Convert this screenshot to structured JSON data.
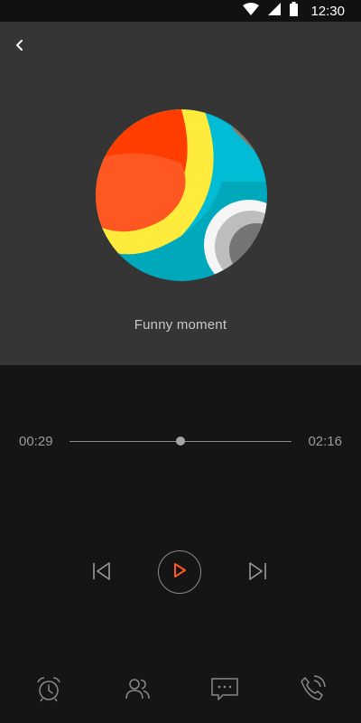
{
  "status_bar": {
    "time": "12:30",
    "icons": [
      "wifi-icon",
      "signal-icon",
      "battery-icon"
    ]
  },
  "header": {
    "back_icon": "chevron-left-icon"
  },
  "track": {
    "title": "Funny moment",
    "elapsed": "00:29",
    "total": "02:16",
    "progress_fraction": 0.5
  },
  "controls": {
    "prev_icon": "skip-previous-icon",
    "play_icon": "play-icon",
    "next_icon": "skip-next-icon"
  },
  "bottom_nav": {
    "items": [
      "alarm-clock-icon",
      "people-icon",
      "chat-icon",
      "phone-ringing-icon"
    ]
  },
  "colors": {
    "accent": "#ff5722",
    "panel": "#353535",
    "background": "#151515"
  }
}
